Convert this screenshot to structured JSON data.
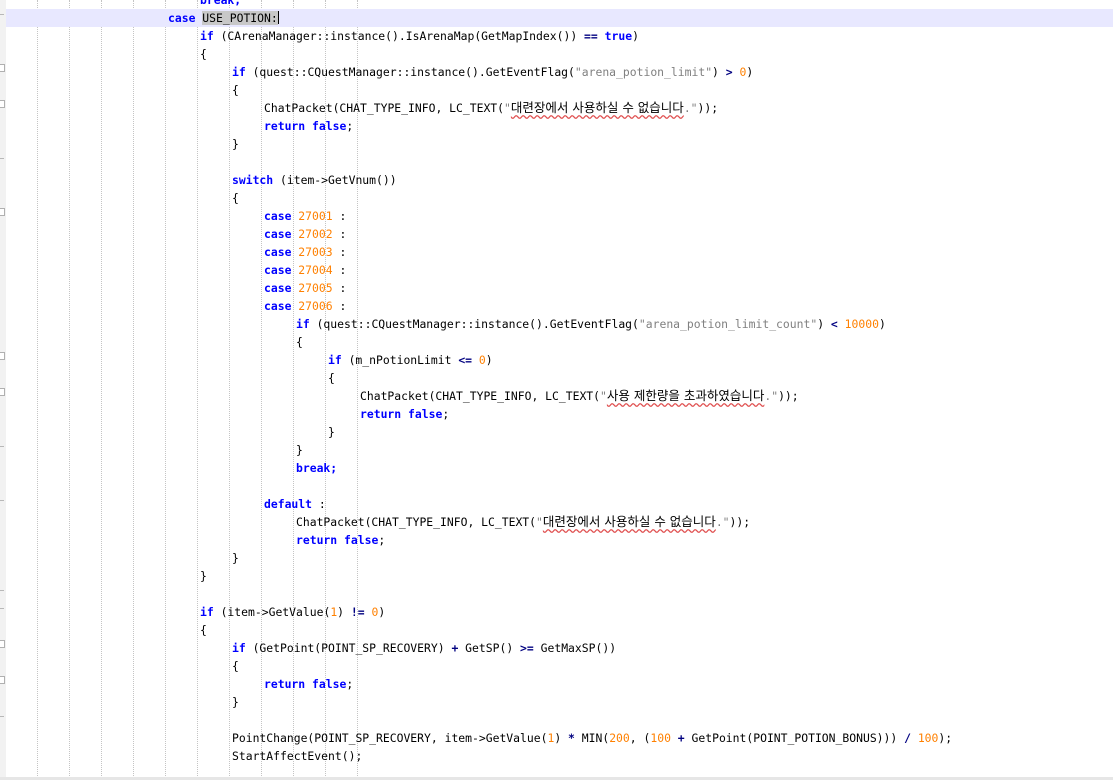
{
  "editor": {
    "lines": [
      {
        "indent": 6,
        "segments": [
          {
            "t": "break;",
            "c": "kw"
          }
        ]
      },
      {
        "indent": 5,
        "current": true,
        "segments": [
          {
            "t": "case",
            "c": "kw"
          },
          {
            "t": " "
          },
          {
            "t": "USE_POTION:",
            "c": "hl"
          },
          {
            "t": "",
            "c": "caret"
          }
        ]
      },
      {
        "indent": 6,
        "segments": [
          {
            "t": "if",
            "c": "kw"
          },
          {
            "t": " (CArenaManager::instance().IsArenaMap(GetMapIndex()) "
          },
          {
            "t": "==",
            "c": "op"
          },
          {
            "t": " "
          },
          {
            "t": "true",
            "c": "kw"
          },
          {
            "t": ")"
          }
        ]
      },
      {
        "indent": 6,
        "segments": [
          {
            "t": "{"
          }
        ]
      },
      {
        "indent": 7,
        "segments": [
          {
            "t": "if",
            "c": "kw"
          },
          {
            "t": " (quest::CQuestManager::instance().GetEventFlag("
          },
          {
            "t": "\"arena_potion_limit\"",
            "c": "str"
          },
          {
            "t": ") "
          },
          {
            "t": ">",
            "c": "op"
          },
          {
            "t": " "
          },
          {
            "t": "0",
            "c": "num"
          },
          {
            "t": ")"
          }
        ]
      },
      {
        "indent": 7,
        "segments": [
          {
            "t": "{"
          }
        ]
      },
      {
        "indent": 8,
        "segments": [
          {
            "t": "ChatPacket(CHAT_TYPE_INFO, LC_TEXT("
          },
          {
            "t": "\"",
            "c": "str"
          },
          {
            "t": "대련장에서 사용하실 수 없습니다",
            "c": "kr"
          },
          {
            "t": ".\"",
            "c": "str"
          },
          {
            "t": "));"
          }
        ]
      },
      {
        "indent": 8,
        "segments": [
          {
            "t": "return",
            "c": "kw"
          },
          {
            "t": " "
          },
          {
            "t": "false",
            "c": "kw"
          },
          {
            "t": ";"
          }
        ]
      },
      {
        "indent": 7,
        "segments": [
          {
            "t": "}"
          }
        ]
      },
      {
        "indent": 0,
        "segments": []
      },
      {
        "indent": 7,
        "segments": [
          {
            "t": "switch",
            "c": "kw"
          },
          {
            "t": " (item->GetVnum())"
          }
        ]
      },
      {
        "indent": 7,
        "segments": [
          {
            "t": "{"
          }
        ]
      },
      {
        "indent": 8,
        "segments": [
          {
            "t": "case",
            "c": "kw"
          },
          {
            "t": " "
          },
          {
            "t": "27001",
            "c": "num"
          },
          {
            "t": " :"
          }
        ]
      },
      {
        "indent": 8,
        "segments": [
          {
            "t": "case",
            "c": "kw"
          },
          {
            "t": " "
          },
          {
            "t": "27002",
            "c": "num"
          },
          {
            "t": " :"
          }
        ]
      },
      {
        "indent": 8,
        "segments": [
          {
            "t": "case",
            "c": "kw"
          },
          {
            "t": " "
          },
          {
            "t": "27003",
            "c": "num"
          },
          {
            "t": " :"
          }
        ]
      },
      {
        "indent": 8,
        "segments": [
          {
            "t": "case",
            "c": "kw"
          },
          {
            "t": " "
          },
          {
            "t": "27004",
            "c": "num"
          },
          {
            "t": " :"
          }
        ]
      },
      {
        "indent": 8,
        "segments": [
          {
            "t": "case",
            "c": "kw"
          },
          {
            "t": " "
          },
          {
            "t": "27005",
            "c": "num"
          },
          {
            "t": " :"
          }
        ]
      },
      {
        "indent": 8,
        "segments": [
          {
            "t": "case",
            "c": "kw"
          },
          {
            "t": " "
          },
          {
            "t": "27006",
            "c": "num"
          },
          {
            "t": " :"
          }
        ]
      },
      {
        "indent": 9,
        "segments": [
          {
            "t": "if",
            "c": "kw"
          },
          {
            "t": " (quest::CQuestManager::instance().GetEventFlag("
          },
          {
            "t": "\"arena_potion_limit_count\"",
            "c": "str"
          },
          {
            "t": ") "
          },
          {
            "t": "<",
            "c": "op"
          },
          {
            "t": " "
          },
          {
            "t": "10000",
            "c": "num"
          },
          {
            "t": ")"
          }
        ]
      },
      {
        "indent": 9,
        "segments": [
          {
            "t": "{"
          }
        ]
      },
      {
        "indent": 10,
        "segments": [
          {
            "t": "if",
            "c": "kw"
          },
          {
            "t": " (m_nPotionLimit "
          },
          {
            "t": "<=",
            "c": "op"
          },
          {
            "t": " "
          },
          {
            "t": "0",
            "c": "num"
          },
          {
            "t": ")"
          }
        ]
      },
      {
        "indent": 10,
        "segments": [
          {
            "t": "{"
          }
        ]
      },
      {
        "indent": 11,
        "segments": [
          {
            "t": "ChatPacket(CHAT_TYPE_INFO, LC_TEXT("
          },
          {
            "t": "\"",
            "c": "str"
          },
          {
            "t": "사용 제한량을 초과하였습니다",
            "c": "kr"
          },
          {
            "t": ".\"",
            "c": "str"
          },
          {
            "t": "));"
          }
        ]
      },
      {
        "indent": 11,
        "segments": [
          {
            "t": "return",
            "c": "kw"
          },
          {
            "t": " "
          },
          {
            "t": "false",
            "c": "kw"
          },
          {
            "t": ";"
          }
        ]
      },
      {
        "indent": 10,
        "segments": [
          {
            "t": "}"
          }
        ]
      },
      {
        "indent": 9,
        "segments": [
          {
            "t": "}"
          }
        ]
      },
      {
        "indent": 9,
        "segments": [
          {
            "t": "break;",
            "c": "kw"
          }
        ]
      },
      {
        "indent": 0,
        "segments": []
      },
      {
        "indent": 8,
        "segments": [
          {
            "t": "default",
            "c": "kw"
          },
          {
            "t": " :"
          }
        ]
      },
      {
        "indent": 9,
        "segments": [
          {
            "t": "ChatPacket(CHAT_TYPE_INFO, LC_TEXT("
          },
          {
            "t": "\"",
            "c": "str"
          },
          {
            "t": "대련장에서 사용하실 수 없습니다",
            "c": "kr"
          },
          {
            "t": ".\"",
            "c": "str"
          },
          {
            "t": "));"
          }
        ]
      },
      {
        "indent": 9,
        "segments": [
          {
            "t": "return",
            "c": "kw"
          },
          {
            "t": " "
          },
          {
            "t": "false",
            "c": "kw"
          },
          {
            "t": ";"
          }
        ]
      },
      {
        "indent": 7,
        "segments": [
          {
            "t": "}"
          }
        ]
      },
      {
        "indent": 6,
        "segments": [
          {
            "t": "}"
          }
        ]
      },
      {
        "indent": 0,
        "segments": []
      },
      {
        "indent": 6,
        "segments": [
          {
            "t": "if",
            "c": "kw"
          },
          {
            "t": " (item->GetValue("
          },
          {
            "t": "1",
            "c": "num"
          },
          {
            "t": ") "
          },
          {
            "t": "!=",
            "c": "op"
          },
          {
            "t": " "
          },
          {
            "t": "0",
            "c": "num"
          },
          {
            "t": ")"
          }
        ]
      },
      {
        "indent": 6,
        "segments": [
          {
            "t": "{"
          }
        ]
      },
      {
        "indent": 7,
        "segments": [
          {
            "t": "if",
            "c": "kw"
          },
          {
            "t": " (GetPoint(POINT_SP_RECOVERY) "
          },
          {
            "t": "+",
            "c": "op"
          },
          {
            "t": " GetSP() "
          },
          {
            "t": ">=",
            "c": "op"
          },
          {
            "t": " GetMaxSP())"
          }
        ]
      },
      {
        "indent": 7,
        "segments": [
          {
            "t": "{"
          }
        ]
      },
      {
        "indent": 8,
        "segments": [
          {
            "t": "return",
            "c": "kw"
          },
          {
            "t": " "
          },
          {
            "t": "false",
            "c": "kw"
          },
          {
            "t": ";"
          }
        ]
      },
      {
        "indent": 7,
        "segments": [
          {
            "t": "}"
          }
        ]
      },
      {
        "indent": 0,
        "segments": []
      },
      {
        "indent": 7,
        "segments": [
          {
            "t": "PointChange(POINT_SP_RECOVERY, item->GetValue("
          },
          {
            "t": "1",
            "c": "num"
          },
          {
            "t": ") "
          },
          {
            "t": "*",
            "c": "op"
          },
          {
            "t": " MIN("
          },
          {
            "t": "200",
            "c": "num"
          },
          {
            "t": ", ("
          },
          {
            "t": "100",
            "c": "num"
          },
          {
            "t": " "
          },
          {
            "t": "+",
            "c": "op"
          },
          {
            "t": " GetPoint(POINT_POTION_BONUS))) "
          },
          {
            "t": "/",
            "c": "op"
          },
          {
            "t": " "
          },
          {
            "t": "100",
            "c": "num"
          },
          {
            "t": ");"
          }
        ]
      },
      {
        "indent": 7,
        "segments": [
          {
            "t": "StartAffectEvent();"
          }
        ]
      }
    ]
  }
}
